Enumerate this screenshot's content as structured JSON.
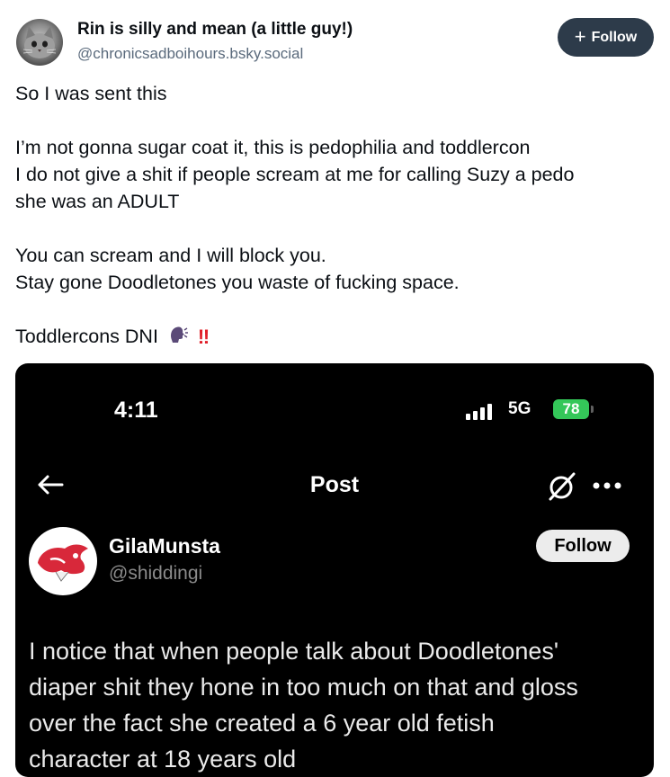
{
  "post": {
    "author_name": "Rin is silly and mean (a little guy!)",
    "author_handle": "@chronicsadboihours.bsky.social",
    "follow_label": "Follow",
    "lines": [
      "So I was sent this",
      "",
      "I’m not gonna sugar coat it, this is pedophilia and toddlercon",
      "I do not give a shit if people scream at me for calling Suzy a pedo",
      "she was an ADULT",
      "",
      "You can scream and I will block you.",
      "Stay gone Doodletones you waste of fucking space.",
      ""
    ],
    "last_line": "Toddlercons DNI",
    "last_line_emoji_bang": "‼"
  },
  "embedded_screenshot": {
    "status_time": "4:11",
    "network": "5G",
    "battery": "78",
    "header_title": "Post",
    "user_name": "GilaMunsta",
    "user_handle": "@shiddingi",
    "follow_label": "Follow",
    "tweet_lines": [
      "I notice that when people talk about Doodletones'",
      "diaper shit they hone in too much on that and gloss",
      "over the fact she created a 6 year old fetish",
      "character at 18 years old"
    ]
  },
  "icons": {
    "follow": "plus-icon",
    "back": "arrow-left-icon",
    "grok": "grok-icon",
    "more": "more-horizontal-icon",
    "signal": "cell-signal-icon",
    "speaking_head": "speaking-head-emoji",
    "double_bang": "double-exclamation-emoji"
  },
  "colors": {
    "follow_button": "#2d3b4a",
    "handle_text": "#5a6a7c",
    "battery": "#34c759",
    "emoji_bang": "#e0202a",
    "embedded_avatar_red": "#d8283a"
  }
}
